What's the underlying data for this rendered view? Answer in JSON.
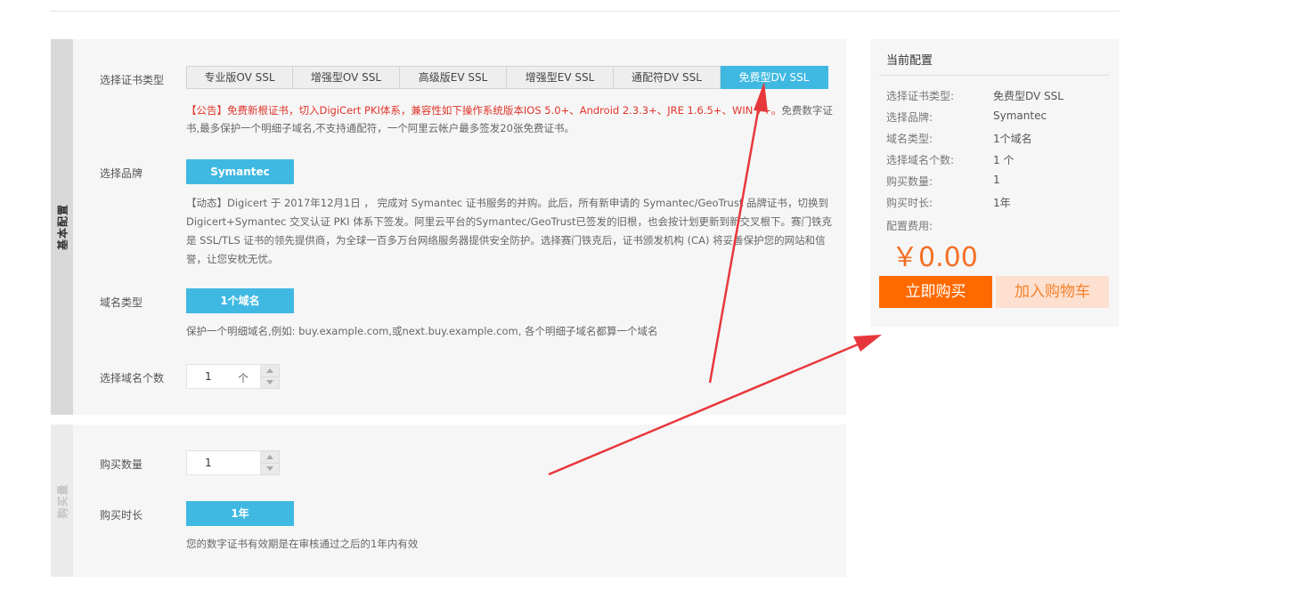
{
  "sections": {
    "basic_label": "基本配置",
    "purchase_label": "购买量"
  },
  "cert_type": {
    "label": "选择证书类型",
    "tabs": [
      "专业版OV SSL",
      "增强型OV SSL",
      "高级版EV SSL",
      "增强型EV SSL",
      "通配符DV SSL",
      "免费型DV SSL"
    ],
    "active_index": 5,
    "notice_red": "【公告】免费新根证书，切入DigiCert PKI体系，兼容性如下操作系统版本IOS 5.0+、Android 2.3.3+、JRE 1.6.5+、WIN 7+。",
    "notice_gray": "免费数字证书,最多保护一个明细子域名,不支持通配符，一个阿里云帐户最多签发20张免费证书。"
  },
  "brand": {
    "label": "选择品牌",
    "button": "Symantec",
    "description": "【动态】Digicert 于 2017年12月1日 ， 完成对 Symantec 证书服务的并购。此后，所有新申请的 Symantec/GeoTrust 品牌证书，切换到 Digicert+Symantec 交叉认证 PKI 体系下签发。阿里云平台的Symantec/GeoTrust已签发的旧根，也会按计划更新到新交叉根下。赛门铁克是 SSL/TLS 证书的领先提供商，为全球一百多万台网络服务器提供安全防护。选择赛门铁克后，证书颁发机构 (CA) 将妥善保护您的网站和信誉，让您安枕无忧。"
  },
  "domain_type": {
    "label": "域名类型",
    "button": "1个域名",
    "description": "保护一个明细域名,例如: buy.example.com,或next.buy.example.com, 各个明细子域名都算一个域名"
  },
  "domain_count": {
    "label": "选择域名个数",
    "value": "1",
    "unit": "个"
  },
  "quantity": {
    "label": "购买数量",
    "value": "1"
  },
  "duration": {
    "label": "购买时长",
    "button": "1年",
    "description": "您的数字证书有效期是在审核通过之后的1年内有效"
  },
  "summary": {
    "title": "当前配置",
    "rows": [
      {
        "key": "选择证书类型:",
        "value": "免费型DV SSL"
      },
      {
        "key": "选择品牌:",
        "value": "Symantec"
      },
      {
        "key": "域名类型:",
        "value": "1个域名"
      },
      {
        "key": "选择域名个数:",
        "value": "1 个"
      },
      {
        "key": "购买数量:",
        "value": "1"
      },
      {
        "key": "购买时长:",
        "value": "1年"
      }
    ],
    "fee_label": "配置费用:",
    "price": "￥0.00",
    "buy_button": "立即购买",
    "cart_button": "加入购物车"
  },
  "colors": {
    "accent_blue": "#40b9e2",
    "notice_red": "#e0352b",
    "price_orange": "#f46f25",
    "buy_orange": "#ff6a00",
    "cart_bg": "#fde0cf",
    "annotation_arrow": "#e8373c"
  }
}
